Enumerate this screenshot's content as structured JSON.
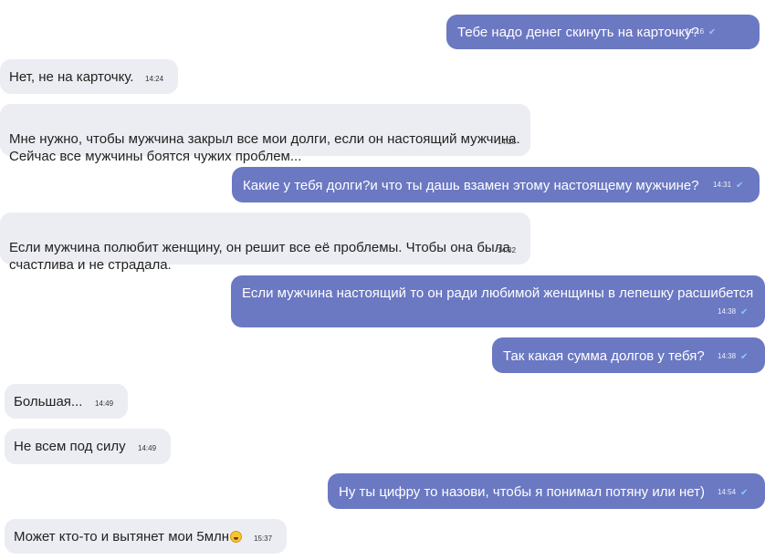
{
  "colors": {
    "incoming_bubble": "#ecedf3",
    "outgoing_bubble": "#6b78c2",
    "read_check": "#8fc7f5"
  },
  "messages": [
    {
      "direction": "out",
      "text": "Тебе надо денег скинуть на карточку?",
      "time": "14:16",
      "read": true
    },
    {
      "direction": "in",
      "text": "Нет, не на карточку.",
      "time": "14:24"
    },
    {
      "direction": "in",
      "text": "Мне нужно, чтобы мужчина закрыл все мои долги, если он настоящий мужчина.\nСейчас все мужчины боятся чужих проблем...",
      "time": "14:25"
    },
    {
      "direction": "out",
      "text": "Какие у тебя долги?и что ты дашь взамен этому настоящему мужчине?",
      "time": "14:31",
      "read": true
    },
    {
      "direction": "in",
      "text": "Если мужчина полюбит женщину, он решит все её проблемы. Чтобы она была\nсчастлива и не страдала.",
      "time": "14:32"
    },
    {
      "direction": "out",
      "text": "Если мужчина настоящий то он ради любимой женщины в лепешку расшибется",
      "time": "14:38",
      "read": true
    },
    {
      "direction": "out",
      "text": "Так какая сумма долгов у тебя?",
      "time": "14:38",
      "read": true
    },
    {
      "direction": "in",
      "text": "Большая...",
      "time": "14:49"
    },
    {
      "direction": "in",
      "text": "Не всем под силу",
      "time": "14:49"
    },
    {
      "direction": "out",
      "text": "Ну ты цифру то назови, чтобы я понимал потяну или нет)",
      "time": "14:54",
      "read": true
    },
    {
      "direction": "in",
      "text": "Может кто-то и вытянет мои 5млн",
      "time": "15:37",
      "icon": "rofl-face-emoji-icon"
    }
  ]
}
